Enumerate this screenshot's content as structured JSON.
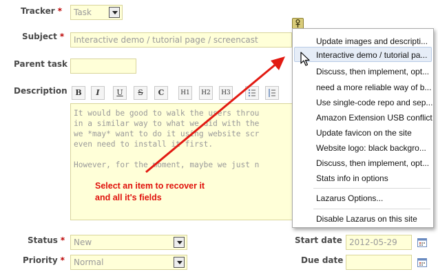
{
  "form": {
    "tracker_label": "Tracker",
    "tracker_value": "Task",
    "subject_label": "Subject",
    "subject_value": "Interactive demo / tutorial page / screencast",
    "parent_label": "Parent task",
    "description_label": "Description",
    "required_mark": "*",
    "status_label": "Status",
    "status_value": "New",
    "priority_label": "Priority",
    "priority_value": "Normal",
    "start_date_label": "Start date",
    "start_date_value": "2012-05-29",
    "due_date_label": "Due date"
  },
  "toolbar": {
    "bold": "B",
    "italic": "I",
    "underline": "U",
    "strike": "S",
    "code": "C",
    "h1": "H1",
    "h2": "H2",
    "h3": "H3"
  },
  "editor": {
    "line1": "It would be good to walk the users throu",
    "line2": "in a similar way to what we did with the",
    "line3": "we *may* want to do it using website scr",
    "line4": "even need to install it first.",
    "line5": "",
    "line6": "However, for the moment, maybe we just n"
  },
  "annotation": {
    "line1": "Select an item to recover it",
    "line2": "and all it's fields",
    "color": "#e0110b"
  },
  "lazarus_menu": {
    "items": [
      "Update images and descripti...",
      "Interactive demo / tutorial pa...",
      "Discuss, then implement, opt...",
      "need a more reliable way of b...",
      "Use single-code repo and sep...",
      "Amazon Extension USB conflict",
      "Update favicon on the site",
      "Website logo: black backgro...",
      "Discuss, then implement, opt...",
      "Stats info in options"
    ],
    "options": "Lazarus Options...",
    "disable": "Disable Lazarus on this site"
  }
}
